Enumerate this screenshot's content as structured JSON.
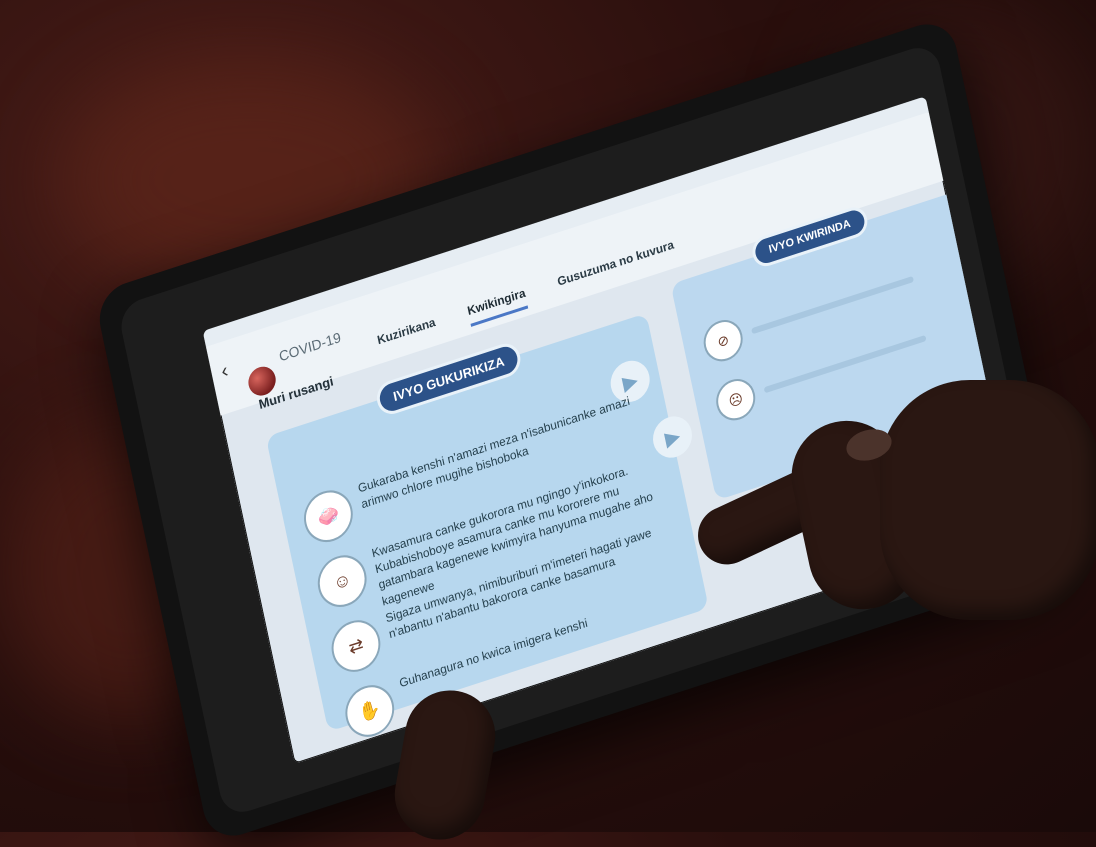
{
  "statusbar": {
    "text": ""
  },
  "app": {
    "back_icon": "back-arrow-icon",
    "icon": "covid-virus-icon",
    "title": "COVID-19",
    "subtitle": "Muri rusangi"
  },
  "tabs": [
    {
      "label": "Kuzirikana",
      "active": false
    },
    {
      "label": "Kwikingira",
      "active": true
    },
    {
      "label": "Gusuzuma no kuvura",
      "active": false
    }
  ],
  "main_card": {
    "header": "IVYO GUKURIKIZA",
    "items": [
      {
        "icon": "handwashing-icon",
        "text": "Gukaraba kenshi n'amazi meza n'isabunicanke amazi arimwo chlore mugihe bishoboka"
      },
      {
        "icon": "person-mask-icon",
        "text": "Kwasamura canke gukorora mu ngingo y'inkokora. Kubabishoboye asamura canke mu kororere mu gatambara kagenewe kwimyira hanyuma mugahe aho kagenewe"
      },
      {
        "icon": "distance-icon",
        "text": "Sigaza umwanya, nimiburiburi m'imeteri hagati yawe n'abantu n'abantu bakorora canke basamura"
      },
      {
        "icon": "avoid-touch-icon",
        "text": "Guhanagura no kwica imigera kenshi"
      }
    ],
    "play_icon": "play-icon"
  },
  "right_card": {
    "header": "IVYO KWIRINDA",
    "items": [
      {
        "icon": "no-handshake-icon"
      },
      {
        "icon": "no-face-touch-icon"
      }
    ]
  },
  "navbar": {
    "back": "nav-back-icon",
    "home": "nav-home-icon",
    "recents": "nav-recents-icon"
  }
}
